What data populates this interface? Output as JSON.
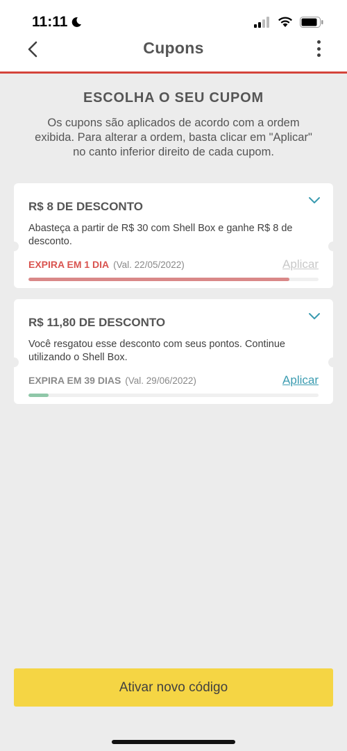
{
  "status": {
    "time": "11:11"
  },
  "header": {
    "title": "Cupons"
  },
  "intro": {
    "heading": "ESCOLHA O SEU CUPOM",
    "text": "Os cupons são aplicados de acordo com a ordem exibida. Para alterar a ordem, basta clicar em \"Aplicar\" no canto inferior direito de cada cupom."
  },
  "coupons": [
    {
      "title": "R$ 8 DE DESCONTO",
      "description": "Abasteça a partir de R$ 30 com Shell Box e ganhe R$ 8 de desconto.",
      "expiry": "EXPIRA EM 1 DIA",
      "validity": "(Val. 22/05/2022)",
      "apply_label": "Aplicar",
      "progress": 0.9,
      "expiry_color": "#d9534f",
      "apply_color": "#c8c8c8",
      "progress_color": "#d98888"
    },
    {
      "title": "R$ 11,80 DE DESCONTO",
      "description": "Você resgatou esse desconto com seus pontos. Continue utilizando o Shell Box.",
      "expiry": "EXPIRA EM 39 DIAS",
      "validity": "(Val. 29/06/2022)",
      "apply_label": "Aplicar",
      "progress": 0.07,
      "expiry_color": "#8a8a8a",
      "apply_color": "#3a9bb0",
      "progress_color": "#8fc7a8"
    }
  ],
  "footer": {
    "button_label": "Ativar novo código"
  },
  "colors": {
    "accent_red": "#d4443b",
    "button_yellow": "#f5d544",
    "chevron_teal": "#3a9bb0"
  }
}
